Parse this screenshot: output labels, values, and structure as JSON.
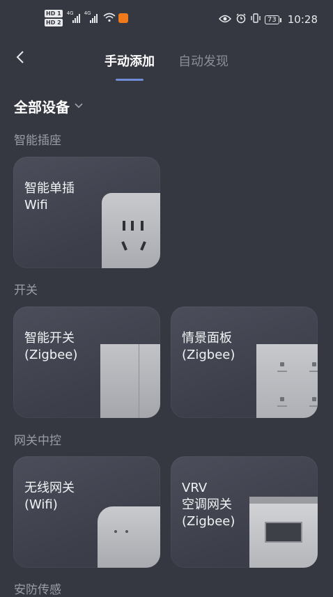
{
  "status_bar": {
    "left_icons": [
      "hd-icon",
      "signal-4g-icon",
      "signal-4g-icon",
      "wifi-icon",
      "app-notification-icon"
    ],
    "hd_label": "HD",
    "sim1": "1",
    "sim2": "2",
    "network": "4G",
    "battery": "73",
    "time": "10:28",
    "right_icons": [
      "eye-icon",
      "alarm-icon",
      "vibrate-icon",
      "battery-icon"
    ]
  },
  "nav": {
    "back_icon": "chevron-left-icon",
    "tabs": [
      {
        "label": "手动添加",
        "active": true
      },
      {
        "label": "自动发现",
        "active": false
      }
    ]
  },
  "filter": {
    "label": "全部设备",
    "icon": "chevron-down-icon"
  },
  "sections": [
    {
      "title": "智能插座",
      "items": [
        {
          "label": "智能单插\nWifi",
          "image": "socket"
        }
      ]
    },
    {
      "title": "开关",
      "items": [
        {
          "label": "智能开关\n(Zigbee)",
          "image": "switch"
        },
        {
          "label": "情景面板\n(Zigbee)",
          "image": "scene-panel"
        }
      ]
    },
    {
      "title": "网关中控",
      "items": [
        {
          "label": "无线网关\n(Wifi)",
          "image": "gateway"
        },
        {
          "label": "VRV\n空调网关\n(Zigbee)",
          "image": "vrv-gateway"
        }
      ]
    },
    {
      "title": "安防传感",
      "items": []
    }
  ],
  "colors": {
    "background": "#353841",
    "card": "#444753",
    "accent": "#6f8cd6",
    "muted_text": "#9a9da6"
  }
}
